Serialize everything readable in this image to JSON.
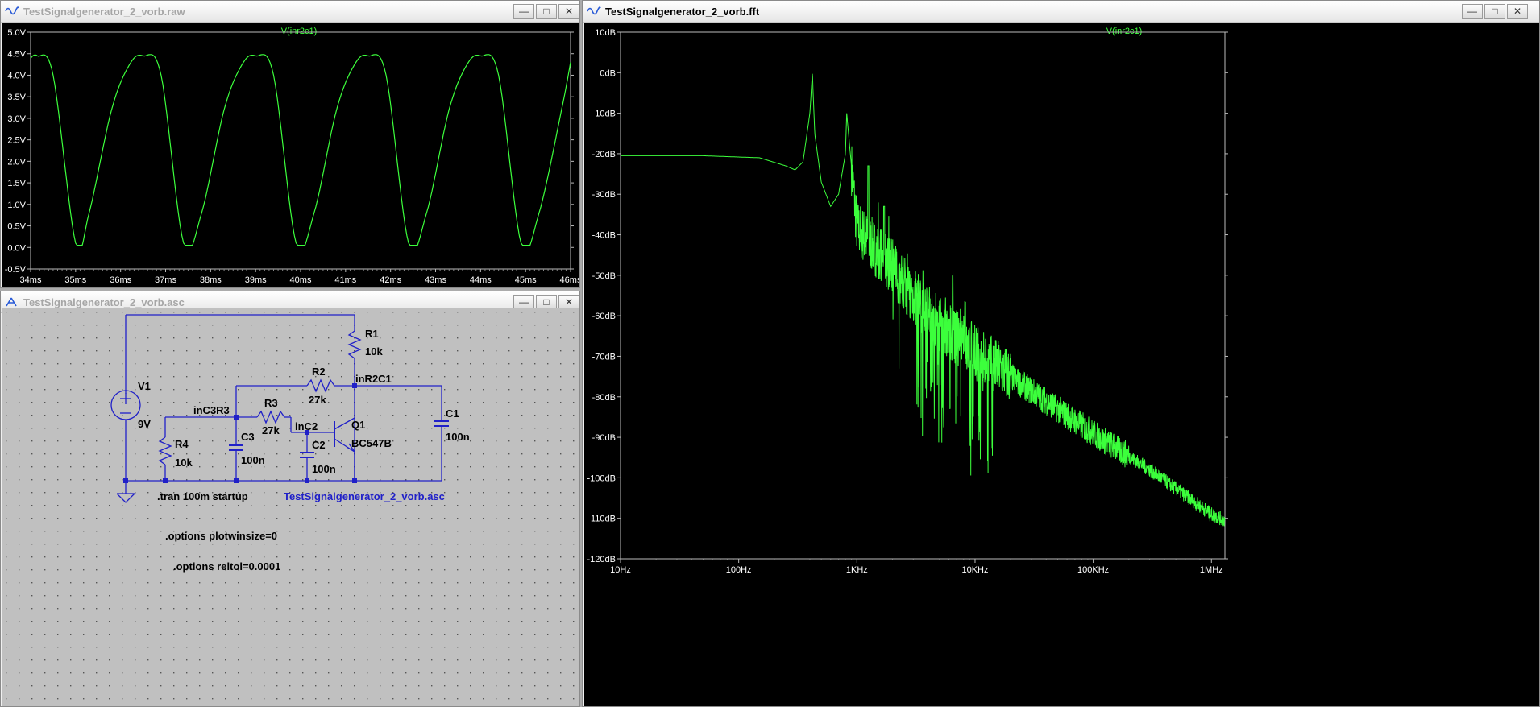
{
  "windows": {
    "transient": {
      "title": "TestSignalgenerator_2_vorb.raw",
      "trace": "V(inr2c1)",
      "y_ticks": [
        "5.0V",
        "4.5V",
        "4.0V",
        "3.5V",
        "3.0V",
        "2.5V",
        "2.0V",
        "1.5V",
        "1.0V",
        "0.5V",
        "0.0V",
        "-0.5V"
      ],
      "x_ticks": [
        "34ms",
        "35ms",
        "36ms",
        "37ms",
        "38ms",
        "39ms",
        "40ms",
        "41ms",
        "42ms",
        "43ms",
        "44ms",
        "45ms",
        "46ms"
      ]
    },
    "schematic": {
      "title": "TestSignalgenerator_2_vorb.asc",
      "labels": {
        "r1_name": "R1",
        "r1_value": "10k",
        "r2_name": "R2",
        "r2_value": "27k",
        "r3_name": "R3",
        "r3_value": "27k",
        "r4_name": "R4",
        "r4_value": "10k",
        "c1_name": "C1",
        "c1_value": "100n",
        "c2_name": "C2",
        "c2_value": "100n",
        "c3_name": "C3",
        "c3_value": "100n",
        "v1_name": "V1",
        "v1_value": "9V",
        "q1_name": "Q1",
        "q1_value": "BC547B",
        "net_inr2c1": "inR2C1",
        "net_inc3r3": "inC3R3",
        "net_inc2": "inC2",
        "tran": ".tran 100m startup",
        "filename": "TestSignalgenerator_2_vorb.asc",
        "opt1": ".options plotwinsize=0",
        "opt2": ".options reltol=0.0001"
      }
    },
    "fft": {
      "title": "TestSignalgenerator_2_vorb.fft",
      "trace": "V(inr2c1)",
      "y_ticks": [
        "10dB",
        "0dB",
        "-10dB",
        "-20dB",
        "-30dB",
        "-40dB",
        "-50dB",
        "-60dB",
        "-70dB",
        "-80dB",
        "-90dB",
        "-100dB",
        "-110dB",
        "-120dB"
      ],
      "x_ticks": [
        "10Hz",
        "100Hz",
        "1KHz",
        "10KHz",
        "100KHz",
        "1MHz"
      ]
    }
  },
  "colors": {
    "trace": "#3cff3c",
    "wire": "#2020c8",
    "title_text": "#3cff3c"
  },
  "chart_data": [
    {
      "type": "line",
      "title": "V(inr2c1)",
      "xlabel": "",
      "ylabel": "",
      "xlim": [
        34,
        46
      ],
      "x_unit": "ms",
      "ylim": [
        -0.5,
        5.0
      ],
      "y_unit": "V",
      "grid": false,
      "series": [
        {
          "name": "V(inr2c1)",
          "x": [
            34.0,
            34.15,
            34.5,
            35.0,
            35.3,
            35.8,
            36.2,
            36.5,
            36.9,
            37.4,
            37.8,
            38.3,
            38.7,
            39.0,
            39.4,
            39.9,
            40.3,
            40.8,
            41.2,
            41.5,
            41.9,
            42.4,
            42.8,
            43.3,
            43.7,
            44.0,
            44.4,
            44.9,
            45.3,
            45.8,
            46.0
          ],
          "y": [
            4.4,
            4.45,
            4.0,
            0.1,
            0.8,
            3.2,
            4.25,
            4.45,
            4.0,
            0.1,
            0.8,
            3.2,
            4.25,
            4.45,
            4.0,
            0.1,
            0.8,
            3.2,
            4.25,
            4.45,
            4.0,
            0.1,
            0.8,
            3.2,
            4.25,
            4.45,
            4.0,
            0.1,
            0.8,
            3.2,
            4.3
          ]
        }
      ]
    },
    {
      "type": "line",
      "title": "V(inr2c1)",
      "xlabel": "",
      "ylabel": "",
      "xscale": "log",
      "xlim": [
        10,
        1300000
      ],
      "x_unit": "Hz",
      "ylim": [
        -120,
        10
      ],
      "y_unit": "dB",
      "grid": false,
      "series": [
        {
          "name": "V(inr2c1)",
          "x": [
            10,
            50,
            150,
            250,
            300,
            350,
            400,
            420,
            440,
            500,
            600,
            700,
            800,
            820,
            1000,
            1200,
            1500,
            2000,
            3000,
            5000,
            8000,
            10000,
            20000,
            50000,
            100000,
            300000,
            1000000,
            1300000
          ],
          "y": [
            -20.5,
            -20.5,
            -21,
            -23,
            -24,
            -22,
            -10,
            0,
            -15,
            -27,
            -33,
            -30,
            -20,
            -10,
            -38,
            -41,
            -44,
            -48,
            -55,
            -62,
            -67,
            -69,
            -75,
            -83,
            -89,
            -98,
            -109,
            -110.5
          ]
        }
      ]
    }
  ]
}
